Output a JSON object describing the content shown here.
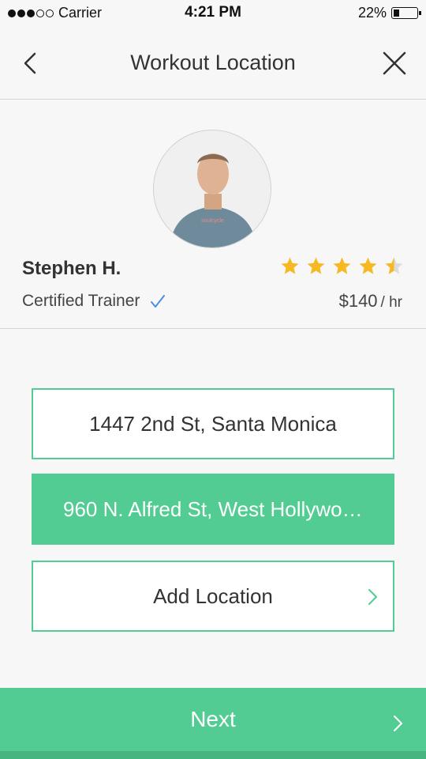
{
  "status_bar": {
    "carrier": "Carrier",
    "time": "4:21 PM",
    "battery": "22%",
    "signal_bars_filled": 3,
    "signal_bars_total": 5
  },
  "nav": {
    "title": "Workout Location",
    "back_icon": "chevron-left-icon",
    "close_icon": "close-icon"
  },
  "trainer": {
    "name": "Stephen H.",
    "title": "Certified Trainer",
    "verified_icon": "checkmark-icon",
    "rating": 4.5,
    "rating_max": 5,
    "price": "$140",
    "price_unit": "/ hr"
  },
  "locations": {
    "items": [
      {
        "label": "1447 2nd St, Santa Monica",
        "selected": false
      },
      {
        "label": "960 N. Alfred St, West Hollywood",
        "selected": true
      }
    ],
    "add_label": "Add Location"
  },
  "footer": {
    "next_label": "Next"
  },
  "colors": {
    "accent": "#52cc93",
    "star": "#f6b922",
    "check": "#4a90e2"
  }
}
